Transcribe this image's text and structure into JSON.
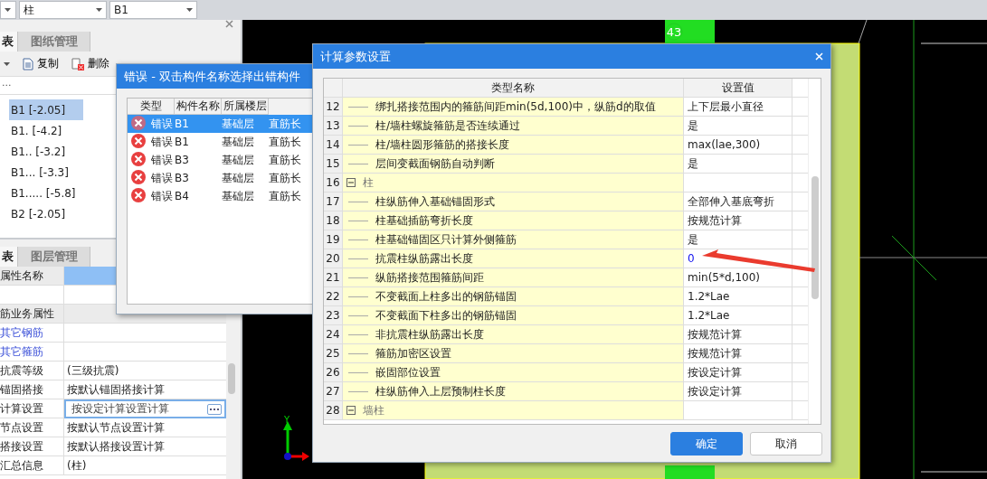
{
  "toolbar": {
    "dropdowns": [
      {
        "value": "柱"
      },
      {
        "value": "B1"
      }
    ]
  },
  "component_panel": {
    "tabs": [
      {
        "label": "表",
        "selected": true
      },
      {
        "label": "图纸管理",
        "selected": false
      }
    ],
    "actions": [
      {
        "label": "复制",
        "kind": "copy"
      },
      {
        "label": "删除",
        "kind": "delete"
      }
    ],
    "search": "...",
    "items": [
      {
        "label": "B1 [-2.05]",
        "selected": true
      },
      {
        "label": "B1. [-4.2]",
        "selected": false
      },
      {
        "label": "B1.. [-3.2]",
        "selected": false
      },
      {
        "label": "B1... [-3.3]",
        "selected": false
      },
      {
        "label": "B1..... [-5.8]",
        "selected": false
      },
      {
        "label": "B2 [-2.05]",
        "selected": false
      }
    ]
  },
  "property_panel": {
    "tabs": [
      {
        "label": "表",
        "selected": true
      },
      {
        "label": "图层管理",
        "selected": false
      }
    ],
    "header": "属性名称",
    "rows": [
      {
        "kind": "blank"
      },
      {
        "kind": "group",
        "name": "筋业务属性"
      },
      {
        "kind": "link",
        "name": "其它钢筋"
      },
      {
        "kind": "link",
        "name": "其它箍筋"
      },
      {
        "kind": "plain",
        "name": "抗震等级",
        "value": "(三级抗震)"
      },
      {
        "kind": "plain",
        "name": "锚固搭接",
        "value": "按默认锚固搭接计算"
      },
      {
        "kind": "edit",
        "name": "计算设置",
        "value": "按设定计算设置计算"
      },
      {
        "kind": "plain",
        "name": "节点设置",
        "value": "按默认节点设置计算"
      },
      {
        "kind": "plain",
        "name": "搭接设置",
        "value": "按默认搭接设置计算"
      },
      {
        "kind": "plain",
        "name": "汇总信息",
        "value": "(柱)"
      }
    ]
  },
  "canvas": {
    "axis_number": "43",
    "axis_label": "Y"
  },
  "error_dialog": {
    "title": "错误 - 双击构件名称选择出错构件",
    "columns": [
      "类型",
      "构件名称",
      "所属楼层"
    ],
    "rows": [
      {
        "type": "错误",
        "name": "B1",
        "floor": "基础层",
        "detail": "直筋长",
        "selected": true
      },
      {
        "type": "错误",
        "name": "B1",
        "floor": "基础层",
        "detail": "直筋长",
        "selected": false
      },
      {
        "type": "错误",
        "name": "B3",
        "floor": "基础层",
        "detail": "直筋长",
        "selected": false
      },
      {
        "type": "错误",
        "name": "B3",
        "floor": "基础层",
        "detail": "直筋长",
        "selected": false
      },
      {
        "type": "错误",
        "name": "B4",
        "floor": "基础层",
        "detail": "直筋长",
        "selected": false
      }
    ]
  },
  "settings_dialog": {
    "title": "计算参数设置",
    "columns": [
      "类型名称",
      "设置值"
    ],
    "rows": [
      {
        "number": "12",
        "kind": "item",
        "name": "绑扎搭接范围内的箍筋间距min(5d,100)中，纵筋d的取值",
        "value": "上下层最小直径",
        "modified": false
      },
      {
        "number": "13",
        "kind": "item",
        "name": "柱/墙柱螺旋箍筋是否连续通过",
        "value": "是",
        "modified": false
      },
      {
        "number": "14",
        "kind": "item",
        "name": "柱/墙柱圆形箍筋的搭接长度",
        "value": "max(lae,300)",
        "modified": false
      },
      {
        "number": "15",
        "kind": "item",
        "name": "层间变截面钢筋自动判断",
        "value": "是",
        "modified": false
      },
      {
        "number": "16",
        "kind": "group",
        "name": "柱",
        "expanded": true
      },
      {
        "number": "17",
        "kind": "item",
        "name": "柱纵筋伸入基础锚固形式",
        "value": "全部伸入基底弯折",
        "modified": false
      },
      {
        "number": "18",
        "kind": "item",
        "name": "柱基础插筋弯折长度",
        "value": "按规范计算",
        "modified": false
      },
      {
        "number": "19",
        "kind": "item",
        "name": "柱基础锚固区只计算外侧箍筋",
        "value": "是",
        "modified": false
      },
      {
        "number": "20",
        "kind": "item",
        "name": "抗震柱纵筋露出长度",
        "value": "0",
        "modified": true
      },
      {
        "number": "21",
        "kind": "item",
        "name": "纵筋搭接范围箍筋间距",
        "value": "min(5*d,100)",
        "modified": false
      },
      {
        "number": "22",
        "kind": "item",
        "name": "不变截面上柱多出的钢筋锚固",
        "value": "1.2*Lae",
        "modified": false
      },
      {
        "number": "23",
        "kind": "item",
        "name": "不变截面下柱多出的钢筋锚固",
        "value": "1.2*Lae",
        "modified": false
      },
      {
        "number": "24",
        "kind": "item",
        "name": "非抗震柱纵筋露出长度",
        "value": "按规范计算",
        "modified": false
      },
      {
        "number": "25",
        "kind": "item",
        "name": "箍筋加密区设置",
        "value": "按规范计算",
        "modified": false
      },
      {
        "number": "26",
        "kind": "item",
        "name": "嵌固部位设置",
        "value": "按设定计算",
        "modified": false
      },
      {
        "number": "27",
        "kind": "item",
        "name": "柱纵筋伸入上层预制柱长度",
        "value": "按设定计算",
        "modified": false
      },
      {
        "number": "28",
        "kind": "group",
        "name": "墙柱",
        "expanded": true
      }
    ],
    "buttons": [
      {
        "label": "确定",
        "primary": true
      },
      {
        "label": "取消",
        "primary": false
      }
    ]
  }
}
